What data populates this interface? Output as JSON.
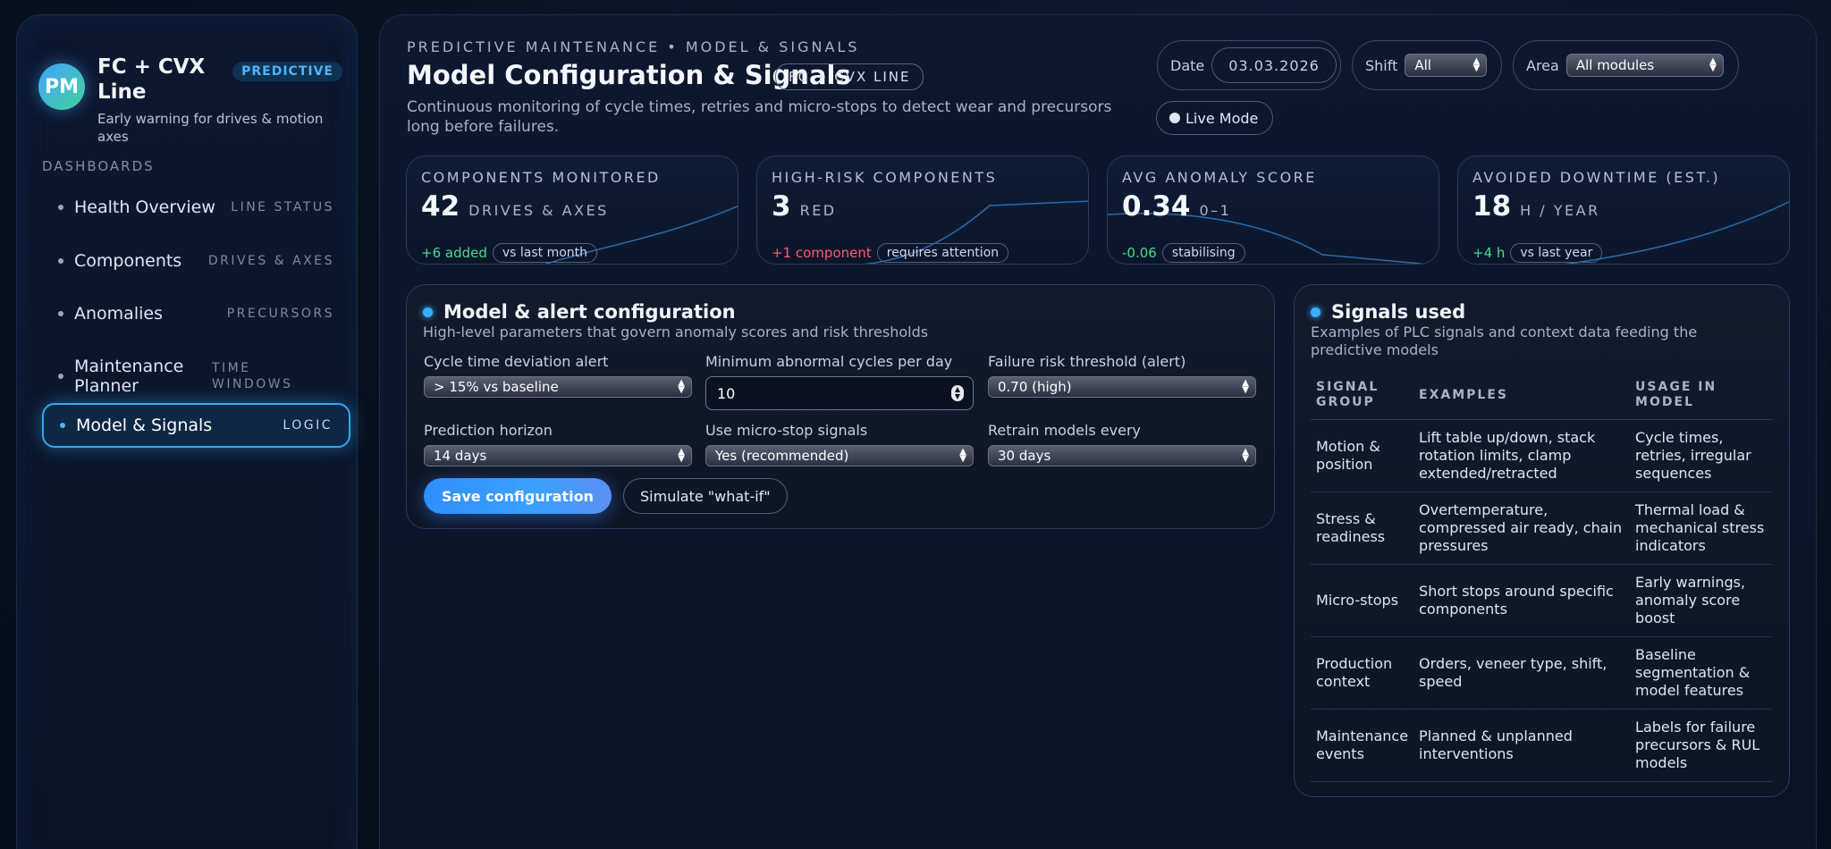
{
  "brand": {
    "logo": "PM",
    "title": "FC + CVX Line",
    "subtitle": "Early warning for drives & motion axes",
    "badge": "PREDICTIVE"
  },
  "nav": {
    "heading": "DASHBOARDS",
    "items": [
      {
        "label": "Health Overview",
        "tag": "LINE STATUS"
      },
      {
        "label": "Components",
        "tag": "DRIVES & AXES"
      },
      {
        "label": "Anomalies",
        "tag": "PRECURSORS"
      },
      {
        "label": "Maintenance Planner",
        "tag": "TIME WINDOWS"
      },
      {
        "label": "Model & Signals",
        "tag": "LOGIC"
      }
    ]
  },
  "header": {
    "eyebrow": "PREDICTIVE MAINTENANCE • MODEL & SIGNALS",
    "title": "Model Configuration & Signals",
    "badge": "FC + CVX LINE",
    "subtitle": "Continuous monitoring of cycle times, retries and micro-stops to detect wear and precursors long before failures."
  },
  "filters": {
    "date_label": "Date",
    "date_value": "03.03.2026",
    "shift_label": "Shift",
    "shift_value": "All",
    "area_label": "Area",
    "area_value": "All modules",
    "live_mode": "Live Mode"
  },
  "kpis": [
    {
      "label": "COMPONENTS MONITORED",
      "value": "42",
      "unit": "DRIVES & AXES",
      "delta": "+6 added",
      "chip": "vs last month"
    },
    {
      "label": "HIGH-RISK COMPONENTS",
      "value": "3",
      "unit": "RED",
      "delta": "+1 component",
      "chip": "requires attention"
    },
    {
      "label": "AVG ANOMALY SCORE",
      "value": "0.34",
      "unit": "0–1",
      "delta": "-0.06",
      "chip": "stabilising"
    },
    {
      "label": "AVOIDED DOWNTIME (EST.)",
      "value": "18",
      "unit": "H / YEAR",
      "delta": "+4 h",
      "chip": "vs last year"
    }
  ],
  "config": {
    "title": "Model & alert configuration",
    "subtitle": "High-level parameters that govern anomaly scores and risk thresholds",
    "fields": {
      "cycle_label": "Cycle time deviation alert",
      "cycle_value": "> 15% vs baseline",
      "min_label": "Minimum abnormal cycles per day",
      "min_value": "10",
      "risk_label": "Failure risk threshold (alert)",
      "risk_value": "0.70 (high)",
      "horizon_label": "Prediction horizon",
      "horizon_value": "14 days",
      "micro_label": "Use micro-stop signals",
      "micro_value": "Yes (recommended)",
      "retrain_label": "Retrain models every",
      "retrain_value": "30 days"
    },
    "save_button": "Save configuration",
    "simulate_button": "Simulate \"what-if\""
  },
  "signals": {
    "title": "Signals used",
    "subtitle": "Examples of PLC signals and context data feeding the predictive models",
    "columns": [
      "SIGNAL GROUP",
      "EXAMPLES",
      "USAGE IN MODEL"
    ],
    "rows": [
      [
        "Motion & position",
        "Lift table up/down, stack rotation limits, clamp extended/retracted",
        "Cycle times, retries, irregular sequences"
      ],
      [
        "Stress & readiness",
        "Overtemperature, compressed air ready, chain pressures",
        "Thermal load & mechanical stress indicators"
      ],
      [
        "Micro-stops",
        "Short stops around specific components",
        "Early warnings, anomaly score boost"
      ],
      [
        "Production context",
        "Orders, veneer type, shift, speed",
        "Baseline segmentation & model features"
      ],
      [
        "Maintenance events",
        "Planned & unplanned interventions",
        "Labels for failure precursors & RUL models"
      ]
    ]
  },
  "colors": {
    "accent": "#3aa6ee",
    "positive": "#4ddb8a",
    "negative": "#ff5e6e"
  }
}
